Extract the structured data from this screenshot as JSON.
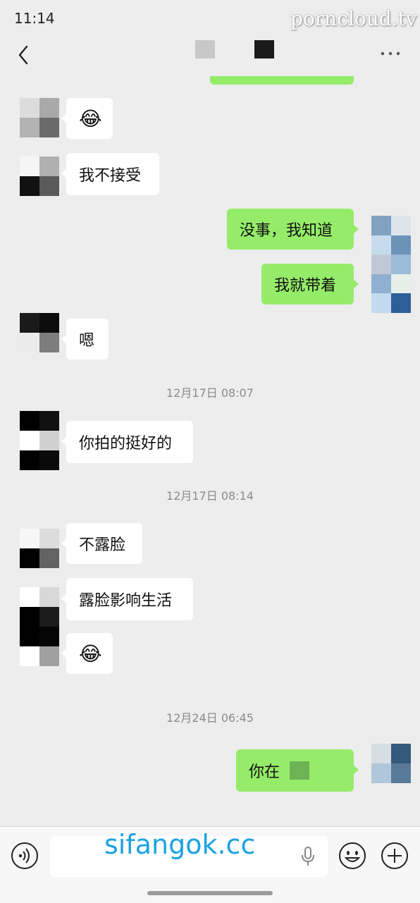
{
  "status_bar": {
    "time": "11:14",
    "watermark": "porncloud.tv"
  },
  "header": {
    "back_icon": "chevron-left-icon",
    "more_icon": "more-dots-icon"
  },
  "messages": [
    {
      "from": "other",
      "text": "😂"
    },
    {
      "from": "other",
      "text": "我不接受"
    },
    {
      "from": "me",
      "text": "没事，我知道"
    },
    {
      "from": "me",
      "text": "我就带着"
    },
    {
      "from": "other",
      "text": "嗯"
    },
    {
      "timestamp": "12月17日 08:07"
    },
    {
      "from": "other",
      "text": "你拍的挺好的"
    },
    {
      "timestamp": "12月17日 08:14"
    },
    {
      "from": "other",
      "text": "不露脸"
    },
    {
      "from": "other",
      "text": "露脸影响生活"
    },
    {
      "from": "other",
      "text": "😂"
    },
    {
      "timestamp": "12月24日 06:45"
    },
    {
      "from": "me",
      "text": "你在"
    }
  ],
  "input_bar": {
    "voice_icon": "voice-icon",
    "mic_icon": "microphone-icon",
    "emoji_icon": "smiley-icon",
    "plus_icon": "plus-circle-icon",
    "watermark": "sifangok.cc"
  },
  "colors": {
    "background": "#ededed",
    "outgoing_bubble": "#95ec69",
    "incoming_bubble": "#ffffff"
  }
}
